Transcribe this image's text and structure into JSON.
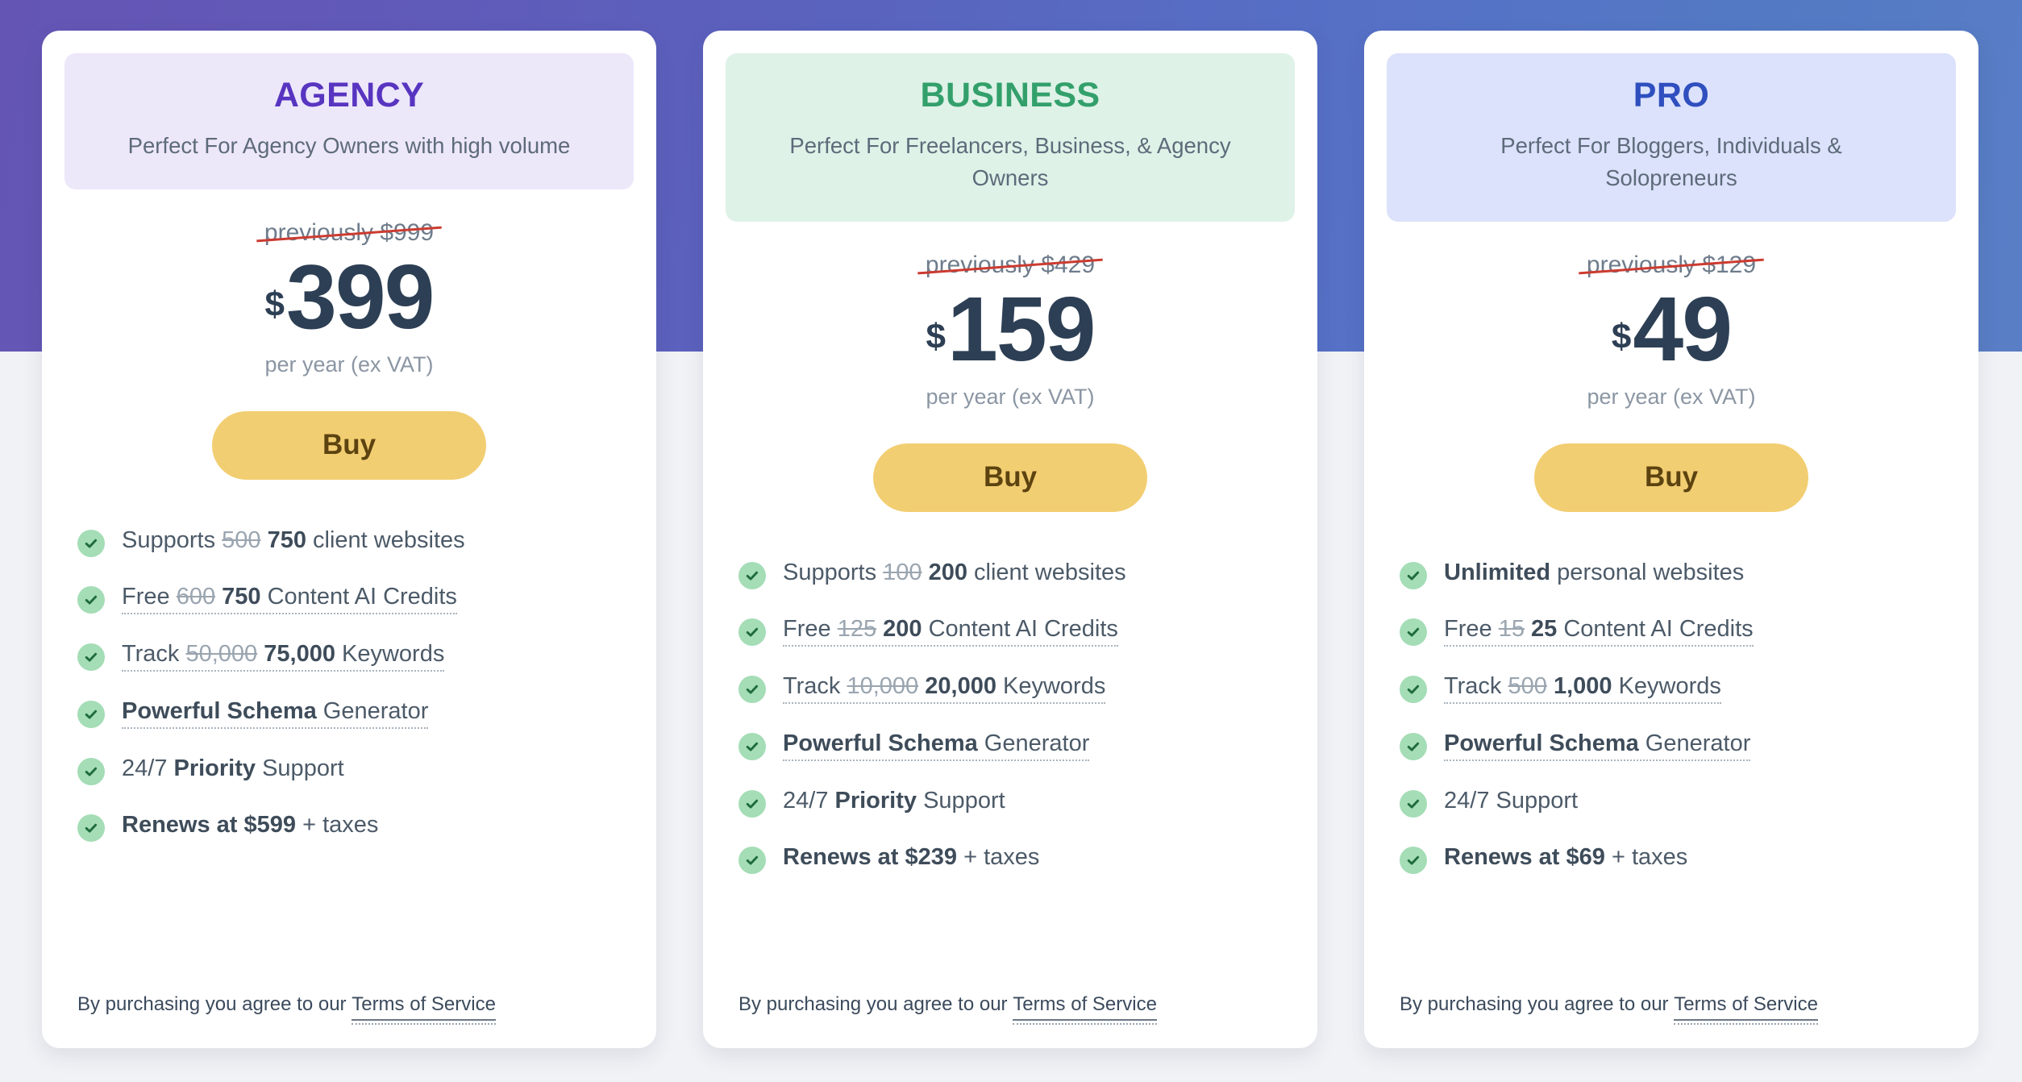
{
  "theme": {
    "gradient_start": "#6455B4",
    "gradient_end": "#5379C4",
    "page_background": "#F1F2F6",
    "card_background": "#FFFFFF",
    "buy_button_background": "#F2CE72",
    "buy_button_text": "#5C4310",
    "check_circle": "#A4DDB6",
    "check_mark": "#1F6B3E",
    "strike_red": "#CC3B30",
    "price_color": "#2D3F54"
  },
  "plans": [
    {
      "id": "agency",
      "name": "AGENCY",
      "name_color": "#5835C0",
      "header_background": "#EDE7FA",
      "tagline": "Perfect For Agency Owners with high volume",
      "previous_price": "previously $999",
      "currency": "$",
      "price": "399",
      "period": "per year (ex VAT)",
      "buy_label": "Buy",
      "features": [
        {
          "tooltip": false,
          "parts": [
            {
              "type": "plain",
              "text": "Supports "
            },
            {
              "type": "old",
              "text": "500"
            },
            {
              "type": "plain",
              "text": " "
            },
            {
              "type": "new",
              "text": "750"
            },
            {
              "type": "plain",
              "text": " client websites"
            }
          ]
        },
        {
          "tooltip": true,
          "parts": [
            {
              "type": "plain",
              "text": "Free "
            },
            {
              "type": "old",
              "text": "600"
            },
            {
              "type": "plain",
              "text": " "
            },
            {
              "type": "new",
              "text": "750"
            },
            {
              "type": "plain",
              "text": " Content AI Credits"
            }
          ]
        },
        {
          "tooltip": true,
          "parts": [
            {
              "type": "plain",
              "text": "Track "
            },
            {
              "type": "old",
              "text": "50,000"
            },
            {
              "type": "plain",
              "text": " "
            },
            {
              "type": "new",
              "text": "75,000"
            },
            {
              "type": "plain",
              "text": " Keywords"
            }
          ]
        },
        {
          "tooltip": true,
          "parts": [
            {
              "type": "bold",
              "text": "Powerful Schema"
            },
            {
              "type": "plain",
              "text": " Generator"
            }
          ]
        },
        {
          "tooltip": false,
          "parts": [
            {
              "type": "plain",
              "text": "24/7 "
            },
            {
              "type": "bold",
              "text": "Priority"
            },
            {
              "type": "plain",
              "text": " Support"
            }
          ]
        },
        {
          "tooltip": false,
          "parts": [
            {
              "type": "bold",
              "text": "Renews at $599"
            },
            {
              "type": "plain",
              "text": " + taxes"
            }
          ]
        }
      ],
      "footer_prefix": "By purchasing you agree to our ",
      "footer_link": "Terms of Service"
    },
    {
      "id": "business",
      "name": "BUSINESS",
      "name_color": "#33A06B",
      "header_background": "#DFF2E8",
      "tagline": "Perfect For Freelancers, Business, & Agency Owners",
      "previous_price": "previously $429",
      "currency": "$",
      "price": "159",
      "period": "per year (ex VAT)",
      "buy_label": "Buy",
      "features": [
        {
          "tooltip": false,
          "parts": [
            {
              "type": "plain",
              "text": "Supports "
            },
            {
              "type": "old",
              "text": "100"
            },
            {
              "type": "plain",
              "text": " "
            },
            {
              "type": "new",
              "text": "200"
            },
            {
              "type": "plain",
              "text": " client websites"
            }
          ]
        },
        {
          "tooltip": true,
          "parts": [
            {
              "type": "plain",
              "text": "Free "
            },
            {
              "type": "old",
              "text": "125"
            },
            {
              "type": "plain",
              "text": " "
            },
            {
              "type": "new",
              "text": "200"
            },
            {
              "type": "plain",
              "text": " Content AI Credits"
            }
          ]
        },
        {
          "tooltip": true,
          "parts": [
            {
              "type": "plain",
              "text": "Track "
            },
            {
              "type": "old",
              "text": "10,000"
            },
            {
              "type": "plain",
              "text": " "
            },
            {
              "type": "new",
              "text": "20,000"
            },
            {
              "type": "plain",
              "text": " Keywords"
            }
          ]
        },
        {
          "tooltip": true,
          "parts": [
            {
              "type": "bold",
              "text": "Powerful Schema"
            },
            {
              "type": "plain",
              "text": " Generator"
            }
          ]
        },
        {
          "tooltip": false,
          "parts": [
            {
              "type": "plain",
              "text": "24/7 "
            },
            {
              "type": "bold",
              "text": "Priority"
            },
            {
              "type": "plain",
              "text": " Support"
            }
          ]
        },
        {
          "tooltip": false,
          "parts": [
            {
              "type": "bold",
              "text": "Renews at $239"
            },
            {
              "type": "plain",
              "text": " + taxes"
            }
          ]
        }
      ],
      "footer_prefix": "By purchasing you agree to our ",
      "footer_link": "Terms of Service"
    },
    {
      "id": "pro",
      "name": "PRO",
      "name_color": "#2F4FBF",
      "header_background": "#DCE2FB",
      "tagline": "Perfect For Bloggers, Individuals & Solopreneurs",
      "previous_price": "previously $129",
      "currency": "$",
      "price": "49",
      "period": "per year (ex VAT)",
      "buy_label": "Buy",
      "features": [
        {
          "tooltip": false,
          "parts": [
            {
              "type": "bold",
              "text": "Unlimited"
            },
            {
              "type": "plain",
              "text": " personal websites"
            }
          ]
        },
        {
          "tooltip": true,
          "parts": [
            {
              "type": "plain",
              "text": "Free "
            },
            {
              "type": "old",
              "text": "15"
            },
            {
              "type": "plain",
              "text": " "
            },
            {
              "type": "new",
              "text": "25"
            },
            {
              "type": "plain",
              "text": " Content AI Credits"
            }
          ]
        },
        {
          "tooltip": true,
          "parts": [
            {
              "type": "plain",
              "text": "Track "
            },
            {
              "type": "old",
              "text": "500"
            },
            {
              "type": "plain",
              "text": " "
            },
            {
              "type": "new",
              "text": "1,000"
            },
            {
              "type": "plain",
              "text": " Keywords"
            }
          ]
        },
        {
          "tooltip": true,
          "parts": [
            {
              "type": "bold",
              "text": "Powerful Schema"
            },
            {
              "type": "plain",
              "text": " Generator"
            }
          ]
        },
        {
          "tooltip": false,
          "parts": [
            {
              "type": "plain",
              "text": "24/7 Support"
            }
          ]
        },
        {
          "tooltip": false,
          "parts": [
            {
              "type": "bold",
              "text": "Renews at $69"
            },
            {
              "type": "plain",
              "text": " + taxes"
            }
          ]
        }
      ],
      "footer_prefix": "By purchasing you agree to our ",
      "footer_link": "Terms of Service"
    }
  ],
  "icons": {
    "check": "check-icon"
  }
}
